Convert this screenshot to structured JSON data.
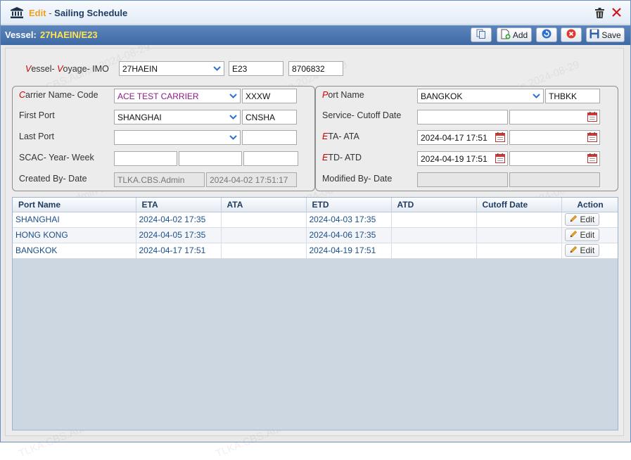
{
  "window": {
    "mode": "Edit",
    "separator": "-",
    "title": "Sailing Schedule",
    "vessel_label": "Vessel:",
    "vessel_value": "27HAEIN/E23"
  },
  "toolbar": {
    "add_label": "Add",
    "save_label": "Save"
  },
  "vessel_row": {
    "label_v": "V",
    "label_essel": "essel- ",
    "label_v2": "V",
    "label_rest": "oyage- IMO",
    "vessel": "27HAEIN",
    "voyage": "E23",
    "imo": "8706832"
  },
  "left_group": {
    "carrier_label_c": "C",
    "carrier_label_rest": "arrier Name- Code",
    "carrier_name": "ACE TEST CARRIER",
    "carrier_code": "XXXW",
    "first_port_label": "First Port",
    "first_port": "SHANGHAI",
    "first_port_code": "CNSHA",
    "last_port_label": "Last Port",
    "last_port": "",
    "last_port_code": "",
    "scac_label": "SCAC- Year- Week",
    "created_label": "Created By- Date",
    "created_by": "TLKA.CBS.Admin",
    "created_date": "2024-04-02 17:51:17"
  },
  "right_group": {
    "port_label_p": "P",
    "port_label_rest": "ort Name",
    "port_name": "BANGKOK",
    "port_code": "THBKK",
    "service_label": "Service- Cutoff Date",
    "eta_label_e": "E",
    "eta_label_rest": "TA- ATA",
    "eta": "2024-04-17 17:51",
    "etd_label_e": "E",
    "etd_label_rest": "TD- ATD",
    "etd": "2024-04-19 17:51",
    "modified_label": "Modified By- Date"
  },
  "grid": {
    "columns": [
      "Port Name",
      "ETA",
      "ATA",
      "ETD",
      "ATD",
      "Cutoff Date",
      "Action"
    ],
    "rows": [
      {
        "port": "SHANGHAI",
        "eta": "2024-04-02 17:35",
        "ata": "",
        "etd": "2024-04-03 17:35",
        "atd": "",
        "cutoff": "",
        "action": "Edit"
      },
      {
        "port": "HONG KONG",
        "eta": "2024-04-05 17:35",
        "ata": "",
        "etd": "2024-04-06 17:35",
        "atd": "",
        "cutoff": "",
        "action": "Edit"
      },
      {
        "port": "BANGKOK",
        "eta": "2024-04-17 17:51",
        "ata": "",
        "etd": "2024-04-19 17:51",
        "atd": "",
        "cutoff": "",
        "action": "Edit"
      }
    ]
  },
  "watermark": "TLKA.CBS.Admin 2024-08-29",
  "icons": {
    "title": "bank-icon",
    "delete": "trash-icon",
    "close": "close-icon",
    "copy": "copy-icon",
    "add": "add-document-icon",
    "refresh": "refresh-icon",
    "cancel": "cancel-icon",
    "save": "floppy-disk-icon",
    "dropdown": "chevron-down-icon",
    "calendar": "calendar-icon",
    "edit": "pencil-icon"
  },
  "colors": {
    "accent": "#f0a01e",
    "title": "#1f3d63",
    "vessel_bar": "#4a74ae",
    "vessel_value": "#ffe44d",
    "grid_text": "#1c4f8a",
    "required": "#cc0000"
  }
}
